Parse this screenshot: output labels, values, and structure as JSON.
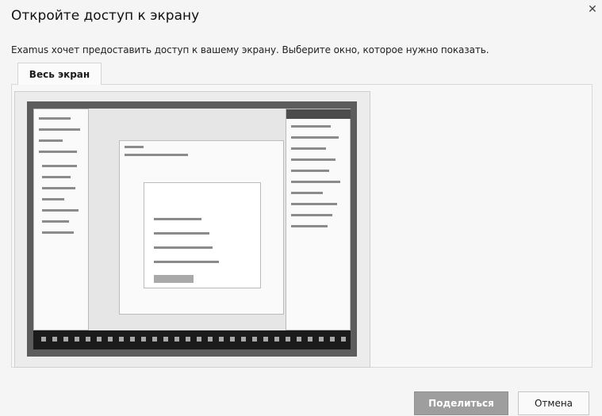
{
  "dialog": {
    "title": "Откройте доступ к экрану",
    "close_icon": "close-icon",
    "description": "Examus хочет предоставить доступ к вашему экрану. Выберите окно, которое нужно показать.",
    "tabs": [
      {
        "label": "Весь экран",
        "selected": true
      }
    ],
    "thumbnail": {
      "content": "screen-preview"
    },
    "buttons": {
      "share_label": "Поделиться",
      "cancel_label": "Отмена"
    }
  }
}
